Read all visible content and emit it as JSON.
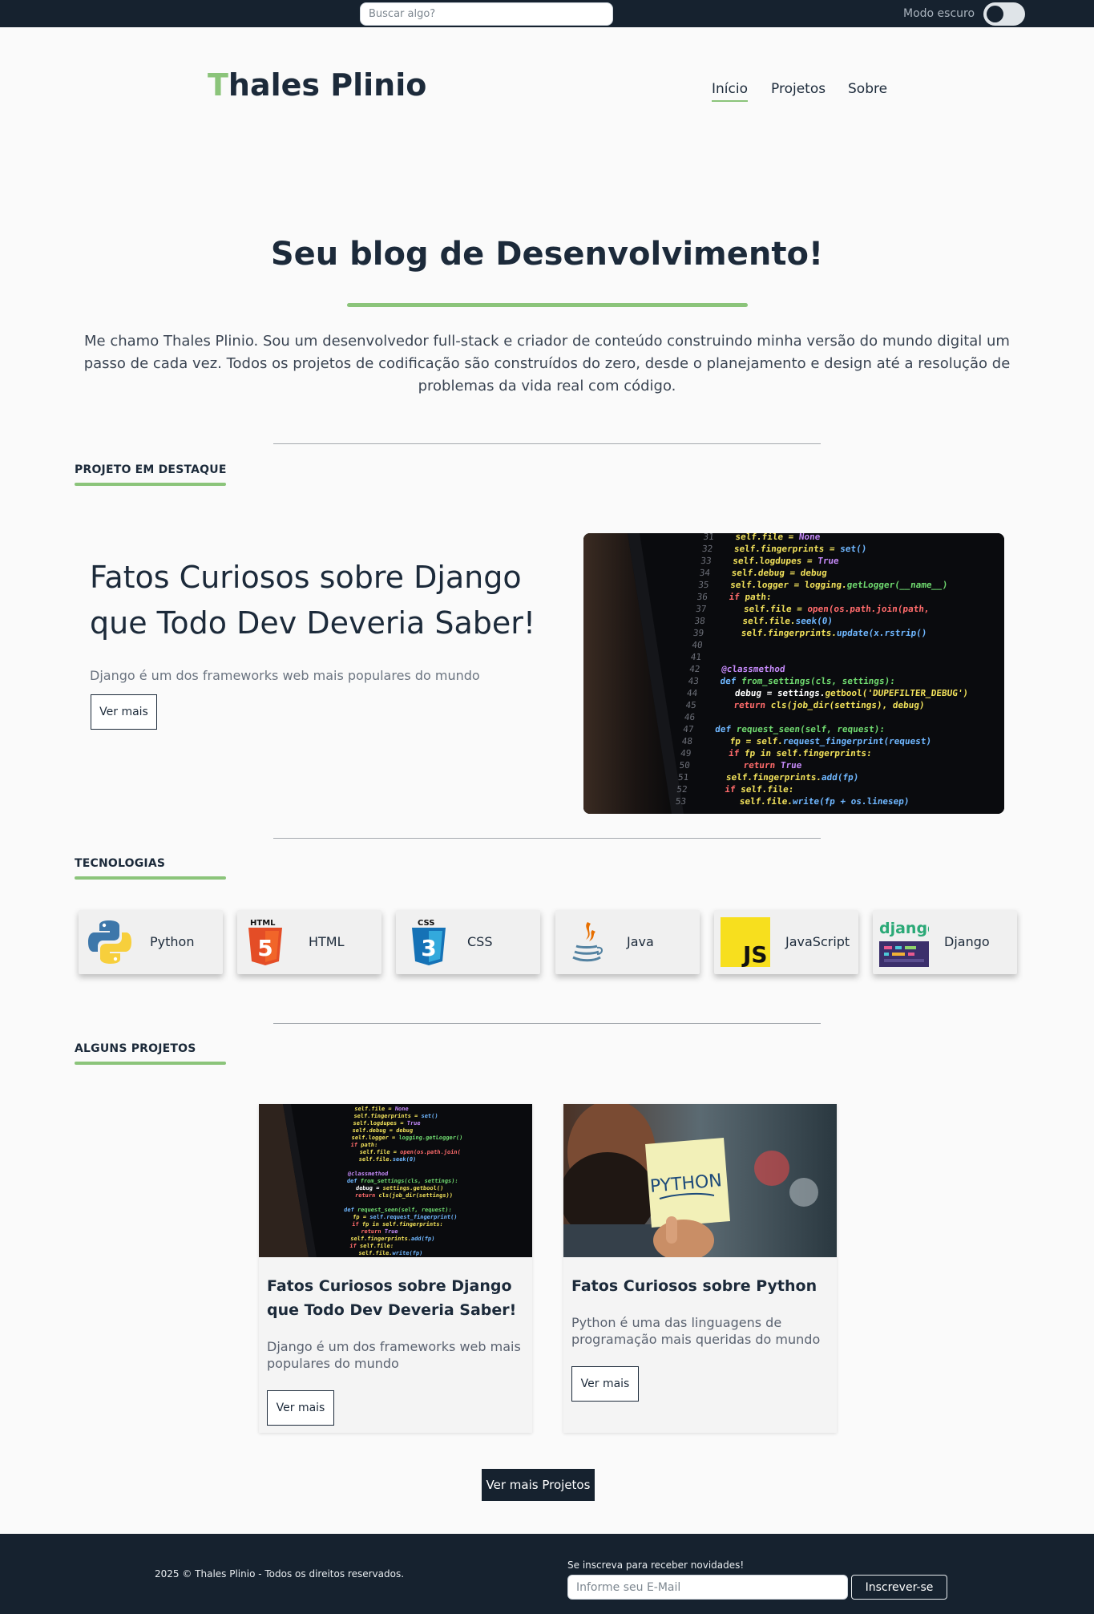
{
  "topbar": {
    "search_placeholder": "Buscar algo?",
    "dark_mode_label": "Modo escuro",
    "dark_mode_on": false
  },
  "header": {
    "logo_first": "T",
    "logo_rest": "hales Plinio",
    "nav": [
      {
        "label": "Início",
        "active": true
      },
      {
        "label": "Projetos",
        "active": false
      },
      {
        "label": "Sobre",
        "active": false
      }
    ]
  },
  "hero": {
    "title": "Seu blog de Desenvolvimento!",
    "text": "Me chamo Thales Plinio. Sou um desenvolvedor full-stack e criador de conteúdo construindo minha versão do mundo digital um passo de cada vez. Todos os projetos de codificação são construídos do zero, desde o planejamento e design até a resolução de problemas da vida real com código."
  },
  "featured": {
    "section_title": "PROJETO EM DESTAQUE",
    "title": "Fatos Curiosos sobre Django que Todo Dev Deveria Saber!",
    "description": "Django é um dos frameworks web mais populares do mundo",
    "button": "Ver mais"
  },
  "technologies": {
    "section_title": "TECNOLOGIAS",
    "items": [
      {
        "label": "Python",
        "icon": "python-icon"
      },
      {
        "label": "HTML",
        "icon": "html5-icon",
        "badge": "HTML"
      },
      {
        "label": "CSS",
        "icon": "css3-icon",
        "badge": "CSS"
      },
      {
        "label": "Java",
        "icon": "java-icon"
      },
      {
        "label": "JavaScript",
        "icon": "javascript-icon",
        "badge": "JS"
      },
      {
        "label": "Django",
        "icon": "django-icon",
        "badge": "django"
      }
    ]
  },
  "projects": {
    "section_title": "ALGUNS PROJETOS",
    "items": [
      {
        "title": "Fatos Curiosos sobre Django que Todo Dev Deveria Saber!",
        "description": "Django é um dos frameworks web mais populares do mundo",
        "button": "Ver mais"
      },
      {
        "title": "Fatos Curiosos sobre Python",
        "description": "Python é uma das linguagens de programação mais queridas do mundo",
        "button": "Ver mais",
        "image_text": "PYTHON"
      }
    ],
    "more_button": "Ver mais Projetos"
  },
  "footer": {
    "copyright": "2025 © Thales Plinio - Todos os direitos reservados.",
    "newsletter_label": "Se inscreva para receber novidades!",
    "email_placeholder": "Informe seu E-Mail",
    "subscribe_button": "Inscrever-se"
  },
  "colors": {
    "accent": "#8bc47a",
    "dark": "#16222f",
    "text": "#1c2a3a"
  }
}
